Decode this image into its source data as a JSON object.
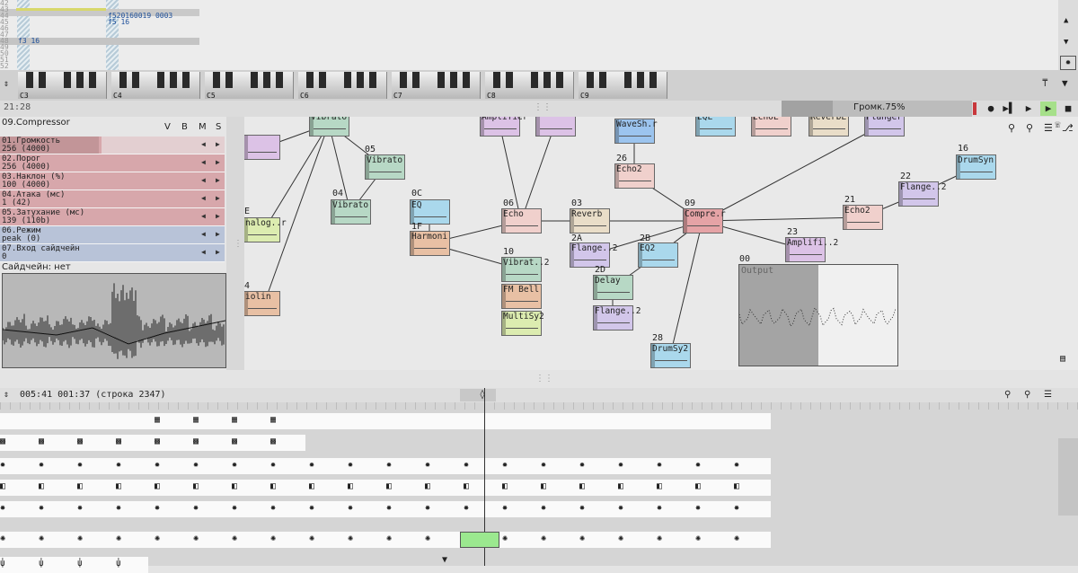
{
  "pattern": {
    "rows": [
      {
        "num": "42",
        "c1": "",
        "c2": ""
      },
      {
        "num": "43",
        "c1": "",
        "c2": ""
      },
      {
        "num": "44",
        "c1": "",
        "c2": "f520160019 0003"
      },
      {
        "num": "45",
        "c1": "",
        "c2": "f5  16"
      },
      {
        "num": "46",
        "c1": "",
        "c2": ""
      },
      {
        "num": "47",
        "c1": "",
        "c2": ""
      },
      {
        "num": "48",
        "c1": "f3  16",
        "c2": ""
      },
      {
        "num": "49",
        "c1": "",
        "c2": ""
      },
      {
        "num": "50",
        "c1": "",
        "c2": ""
      },
      {
        "num": "51",
        "c1": "",
        "c2": ""
      },
      {
        "num": "52",
        "c1": "",
        "c2": ""
      }
    ]
  },
  "keyboard": {
    "octaves": [
      "C3",
      "C4",
      "C5",
      "C6",
      "C7",
      "C8",
      "C9"
    ]
  },
  "transport": {
    "time": "21:28",
    "volume_label": "Громк.75%",
    "volume": 0.75
  },
  "module_panel": {
    "title": "09.Compressor",
    "flags": [
      "V",
      "B",
      "M",
      "S"
    ],
    "params": [
      {
        "name": "01.Громкость",
        "value": "256 (4000)",
        "fill": 0.45,
        "color": "#d7a7ab"
      },
      {
        "name": "02.Порог",
        "value": "256 (4000)",
        "fill": 1.0,
        "color": "#d7a7ab"
      },
      {
        "name": "03.Наклон (%)",
        "value": "100 (4000)",
        "fill": 1.0,
        "color": "#d7a7ab"
      },
      {
        "name": "04.Атака (мс)",
        "value": "1 (42)",
        "fill": 1.0,
        "color": "#d7a7ab"
      },
      {
        "name": "05.Затухание (мс)",
        "value": "139 (110b)",
        "fill": 1.0,
        "color": "#d7a7ab"
      },
      {
        "name": "06.Режим",
        "value": "peak (0)",
        "fill": 1.0,
        "color": "#b8c3d8"
      },
      {
        "name": "07.Вход сайдчейн",
        "value": "0",
        "fill": 1.0,
        "color": "#b8c3d8"
      }
    ],
    "sidechain": "Сайдчейн: нет"
  },
  "modules": [
    {
      "num": "",
      "name": "Vibrato",
      "color": "#b7d8c5"
    },
    {
      "num": "",
      "name": "Amplifier",
      "color": "#dcc2e6"
    },
    {
      "num": "",
      "name": "",
      "color": "#dcc2e6"
    },
    {
      "num": "",
      "name": "WaveSh.r",
      "color": "#9cc4ee"
    },
    {
      "num": "",
      "name": "EQL",
      "color": "#aad8ec"
    },
    {
      "num": "",
      "name": "EchoL",
      "color": "#f0d0cc"
    },
    {
      "num": "",
      "name": "ReverbL",
      "color": "#e9ddc8"
    },
    {
      "num": "",
      "name": "Flanger",
      "color": "#d2c6ea"
    },
    {
      "num": "",
      "name": "",
      "color": "#dcc2e6"
    },
    {
      "num": "05",
      "name": "Vibrato",
      "color": "#b7d8c5"
    },
    {
      "num": "04",
      "name": "Vibrato",
      "color": "#b7d8c5"
    },
    {
      "num": "0C",
      "name": "EQ",
      "color": "#aad8ec"
    },
    {
      "num": "1F",
      "name": "Harmoni",
      "color": "#e8c0a4"
    },
    {
      "num": "06",
      "name": "Echo",
      "color": "#f0d0cc"
    },
    {
      "num": "03",
      "name": "Reverb",
      "color": "#e9ddc8"
    },
    {
      "num": "26",
      "name": "Echo2",
      "color": "#f0d0cc"
    },
    {
      "num": "09",
      "name": "Compre.r",
      "color": "#e5a3a6"
    },
    {
      "num": "16",
      "name": "DrumSyn",
      "color": "#aad8ec"
    },
    {
      "num": "22",
      "name": "Flange..2",
      "color": "#d2c6ea"
    },
    {
      "num": "21",
      "name": "Echo2",
      "color": "#f0d0cc"
    },
    {
      "num": "23",
      "name": "Amplifi..2",
      "color": "#dcc2e6"
    },
    {
      "num": "E",
      "name": "nalog..r",
      "color": "#dcecb0"
    },
    {
      "num": "10",
      "name": "Vibrat..2",
      "color": "#b7d8c5"
    },
    {
      "num": "",
      "name": "FM Bell",
      "color": "#e8c0a4"
    },
    {
      "num": "",
      "name": "MultiSy2",
      "color": "#dcecb0"
    },
    {
      "num": "2A",
      "name": "Flange..2",
      "color": "#d2c6ea"
    },
    {
      "num": "2B",
      "name": "EQ2",
      "color": "#aad8ec"
    },
    {
      "num": "2D",
      "name": "Delay",
      "color": "#b7d8c5"
    },
    {
      "num": "",
      "name": "Flange..2",
      "color": "#d2c6ea"
    },
    {
      "num": "28",
      "name": "DrumSy2",
      "color": "#aad8ec"
    },
    {
      "num": "4",
      "name": "iolin",
      "color": "#e8c0a4"
    }
  ],
  "output": {
    "num": "00",
    "label": "Output"
  },
  "timeline": {
    "status": "005:41  001:37 (строка 2347)"
  }
}
